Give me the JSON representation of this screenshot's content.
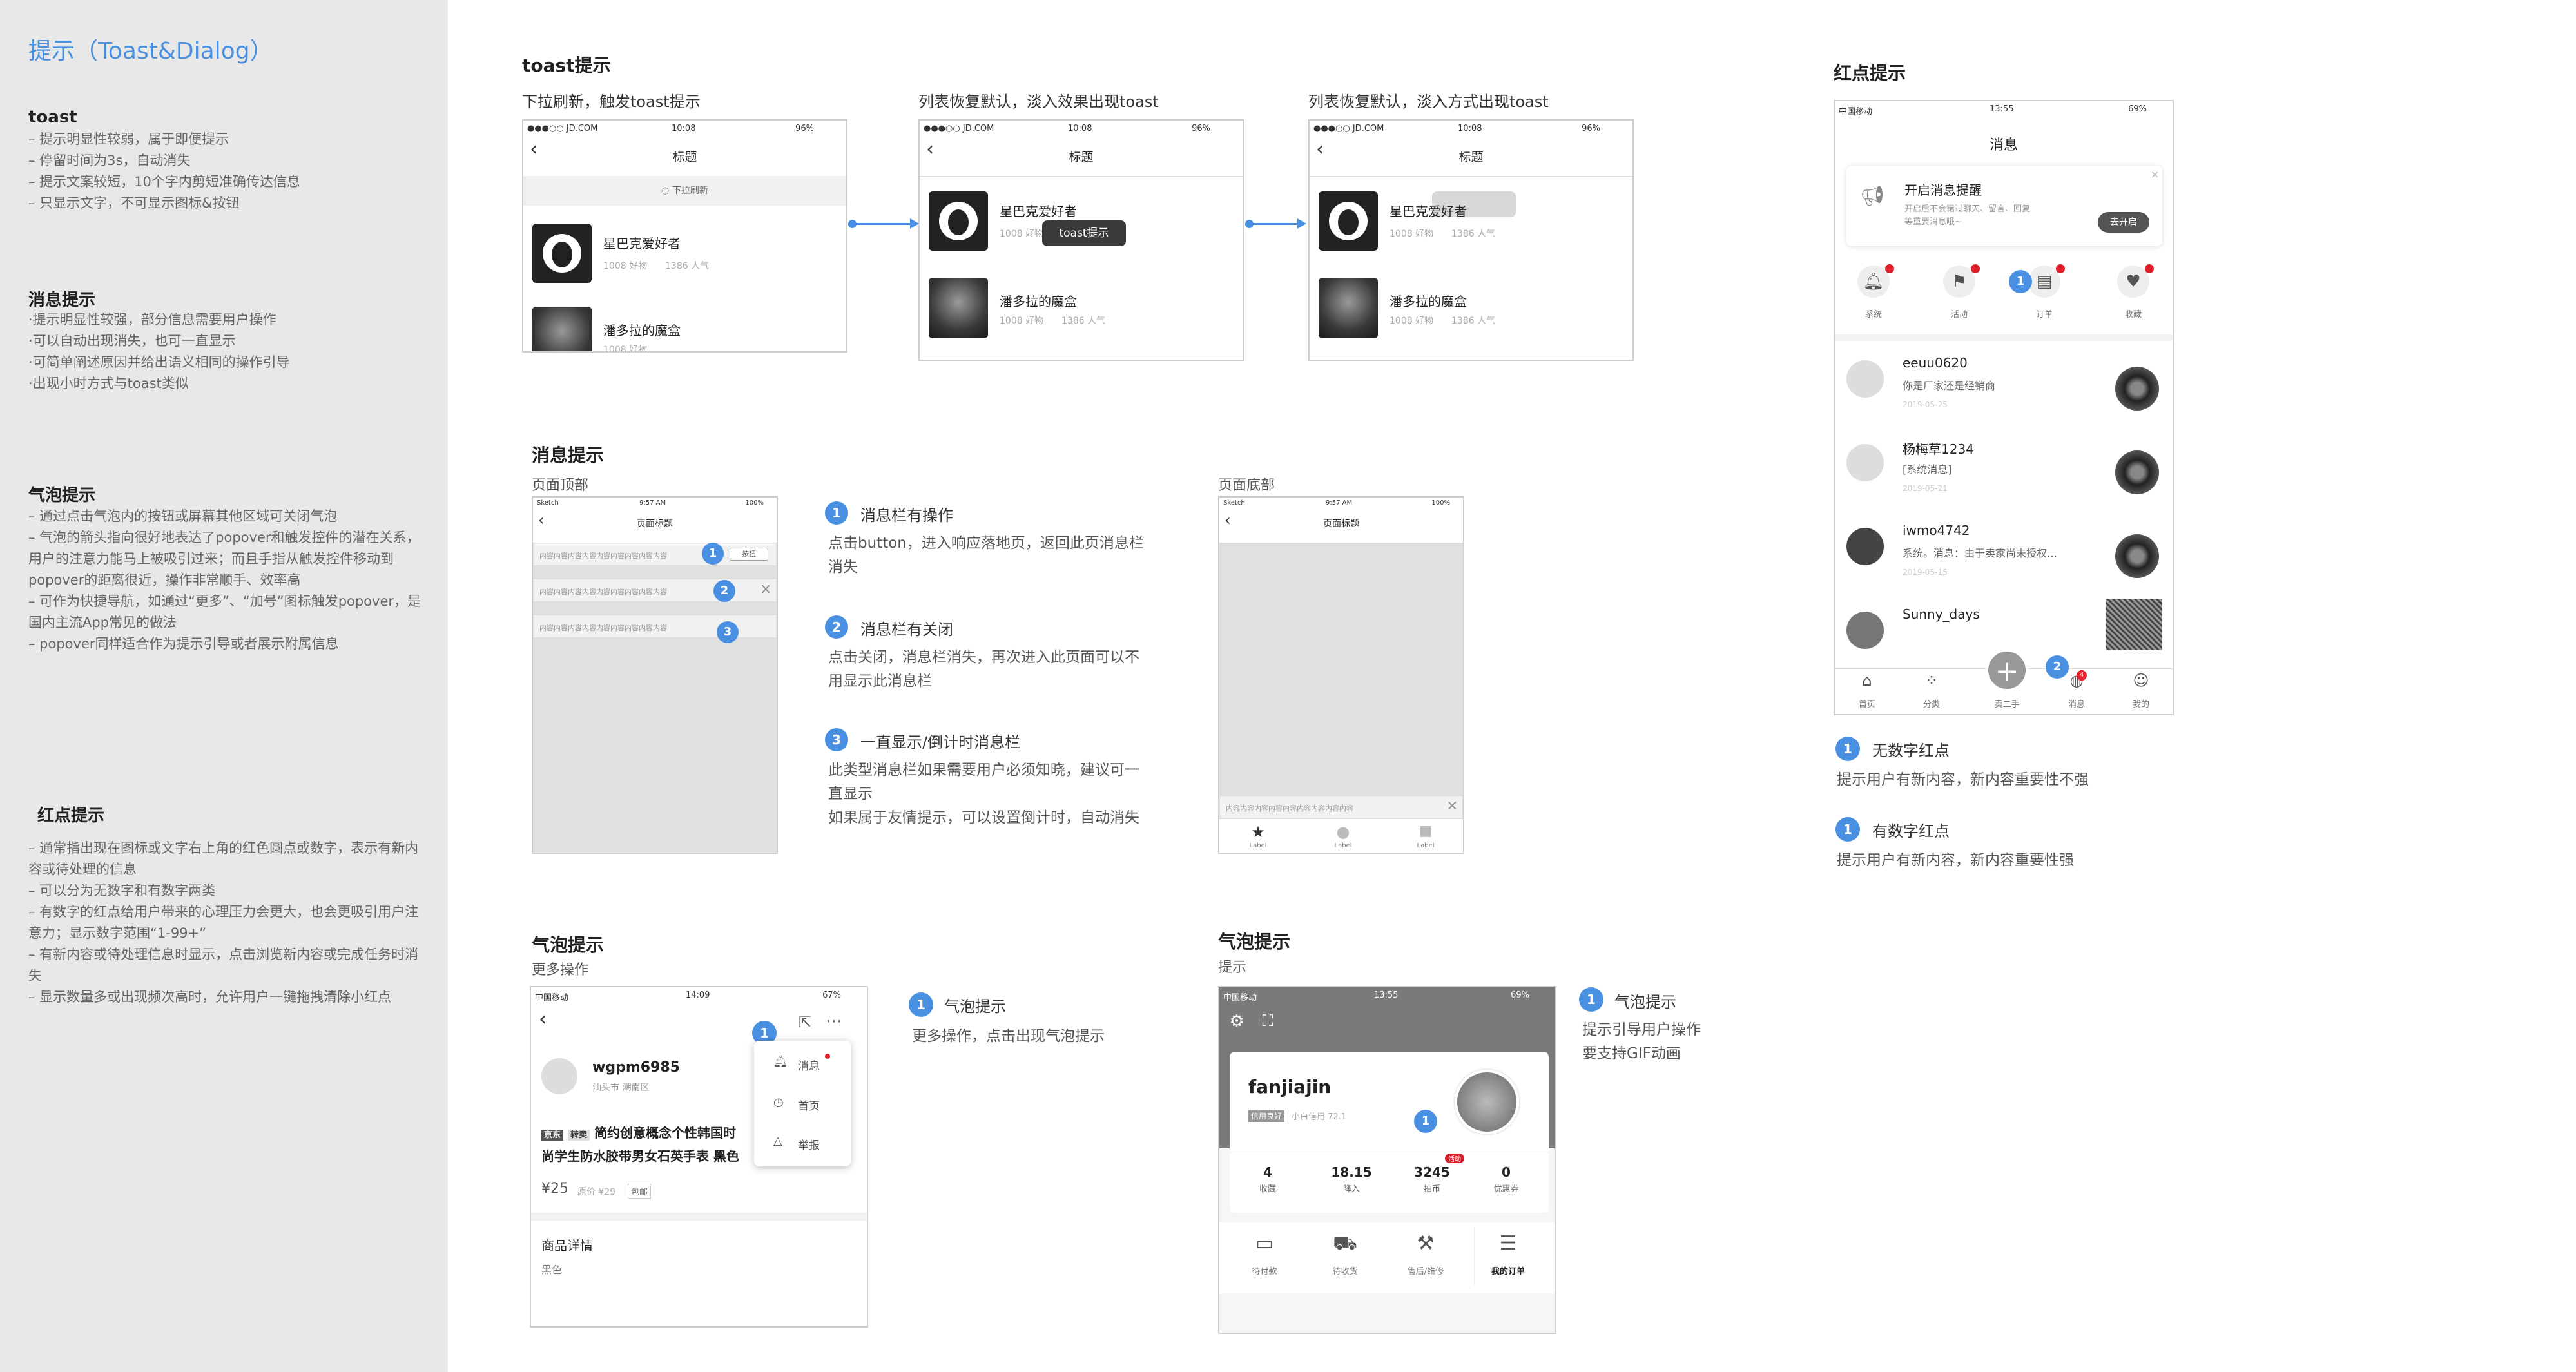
{
  "sidebar": {
    "title": "提示（Toast&Dialog）",
    "toast": {
      "heading": "toast",
      "lines": [
        "– 提示明显性较弱，属于即便提示",
        "– 停留时间为3s，自动消失",
        "– 提示文案较短，10个字内剪短准确传达信息",
        "– 只显示文字，不可显示图标&按钮"
      ]
    },
    "msg": {
      "heading": "消息提示",
      "lines": [
        "·提示明显性较强，部分信息需要用户操作",
        "·可以自动出现消失，也可一直显示",
        "·可简单阐述原因并给出语义相同的操作引导",
        "·出现小时方式与toast类似"
      ]
    },
    "bubble": {
      "heading": "气泡提示",
      "lines": [
        "– 通过点击气泡内的按钮或屏幕其他区域可关闭气泡",
        "– 气泡的箭头指向很好地表达了popover和触发控件的潜在关系，用户的注意力能马上被吸引过来；而且手指从触发控件移动到popover的距离很近，操作非常顺手、效率高",
        "– 可作为快捷导航，如通过“更多”、“加号”图标触发popover，是国内主流App常见的做法",
        "– popover同样适合作为提示引导或者展示附属信息"
      ]
    },
    "red": {
      "heading": "红点提示",
      "lines": [
        "– 通常指出现在图标或文字右上角的红色圆点或数字，表示有新内容或待处理的信息",
        "– 可以分为无数字和有数字两类",
        "– 有数字的红点给用户带来的心理压力会更大，也会更吸引用户注意力；显示数字范围“1-99+”",
        "– 有新内容或待处理信息时显示，点击浏览新内容或完成任务时消失",
        "– 显示数量多或出现频次高时，允许用户一键拖拽清除小红点"
      ]
    }
  },
  "toast_section": {
    "title": "toast提示",
    "captions": [
      "下拉刷新，触发toast提示",
      "列表恢复默认，淡入效果出现toast",
      "列表恢复默认，淡入方式出现toast"
    ],
    "status": {
      "carrier": "●●●○○ JD.COM",
      "time": "10:08",
      "battery": "96%"
    },
    "nav_title": "标题",
    "refresh": "下拉刷新",
    "toast_text": "toast提示",
    "items": [
      {
        "name": "星巴克爱好者",
        "meta1": "1008 好物",
        "meta2": "1386 人气"
      },
      {
        "name": "潘多拉的魔盒",
        "meta1": "1008 好物",
        "meta2": "1386 人气"
      }
    ]
  },
  "msg_section": {
    "title": "消息提示",
    "top_label": "页面顶部",
    "bottom_label": "页面底部",
    "status": {
      "carrier": "Sketch",
      "time": "9:57 AM",
      "battery": "100%"
    },
    "nav_title": "页面标题",
    "bar_text": "内容内容内容内容内容内容内容内容内容",
    "btn": "按钮",
    "badges": [
      "1",
      "2",
      "3"
    ],
    "tabs": [
      "Label",
      "Label",
      "Label"
    ],
    "desc": [
      {
        "num": "1",
        "title": "消息栏有操作",
        "text": "点击button，进入响应落地页，返回此页消息栏消失"
      },
      {
        "num": "2",
        "title": "消息栏有关闭",
        "text": "点击关闭，消息栏消失，再次进入此页面可以不用显示此消息栏"
      },
      {
        "num": "3",
        "title": "一直显示/倒计时消息栏",
        "text": "此类型消息栏如果需要用户必须知晓，建议可一直显示\n如果属于友情提示，可以设置倒计时，自动消失"
      }
    ]
  },
  "bubble_section": {
    "title": "气泡提示",
    "sub": "更多操作",
    "status": {
      "carrier": "中国移动",
      "time": "14:09",
      "battery": "67%"
    },
    "user": "wgpm6985",
    "user_loc": "汕头市 潮南区",
    "tag1": "京东",
    "tag2": "转卖",
    "product": "简约创意概念个性韩国时尚学生防水胶带男女石英手表 黑色",
    "price": "¥25",
    "orig_price": "原价 ¥29",
    "ship": "包邮",
    "detail_title": "商品详情",
    "detail_val": "黑色",
    "menu": [
      "消息",
      "首页",
      "举报"
    ],
    "badge": "1",
    "desc_num": "1",
    "desc_title": "气泡提示",
    "desc_text": "更多操作，点击出现气泡提示"
  },
  "bubble2_section": {
    "title": "气泡提示",
    "sub": "提示",
    "status": {
      "carrier": "中国移动",
      "time": "13:55",
      "battery": "69%"
    },
    "user": "fanjiajin",
    "credit_tag": "信用良好",
    "credit": "小白信用 72.1",
    "stats": [
      {
        "v": "4",
        "l": "收藏"
      },
      {
        "v": "18.15",
        "l": "降入"
      },
      {
        "v": "3245",
        "l": "拍币"
      },
      {
        "v": "0",
        "l": "优惠券"
      }
    ],
    "hot": "活动",
    "orders": [
      "待付款",
      "待收货",
      "售后/维修",
      "我的订单"
    ],
    "badge": "1",
    "desc_num": "1",
    "desc_title": "气泡提示",
    "desc_lines": [
      "提示引导用户操作",
      "要支持GIF动画"
    ]
  },
  "red_section": {
    "title": "红点提示",
    "status": {
      "carrier": "中国移动",
      "time": "13:55",
      "battery": "69%"
    },
    "nav_title": "消息",
    "notice_title": "开启消息提醒",
    "notice_text": "开启后不会错过聊天、留言、回复等重要消息哦~",
    "notice_btn": "去开启",
    "icons": [
      "系统",
      "活动",
      "订单",
      "收藏"
    ],
    "messages": [
      {
        "name": "eeuu0620",
        "text": "你是厂家还是经销商",
        "time": "2019-05-25"
      },
      {
        "name": "杨梅草1234",
        "text": "[系统消息]",
        "time": "2019-05-21"
      },
      {
        "name": "iwmo4742",
        "text": "系统。消息：由于卖家尚未授权…",
        "time": "2019-05-15"
      },
      {
        "name": "Sunny_days",
        "text": "",
        "time": ""
      }
    ],
    "tabs": [
      "首页",
      "分类",
      "卖二手",
      "消息",
      "我的"
    ],
    "tab_badge": "2",
    "tab_badge_num": "4",
    "badge1": "1",
    "badge2": "2",
    "desc": [
      {
        "num": "1",
        "title": "无数字红点",
        "text": "提示用户有新内容，新内容重要性不强"
      },
      {
        "num": "1",
        "title": "有数字红点",
        "text": "提示用户有新内容，新内容重要性强"
      }
    ]
  }
}
